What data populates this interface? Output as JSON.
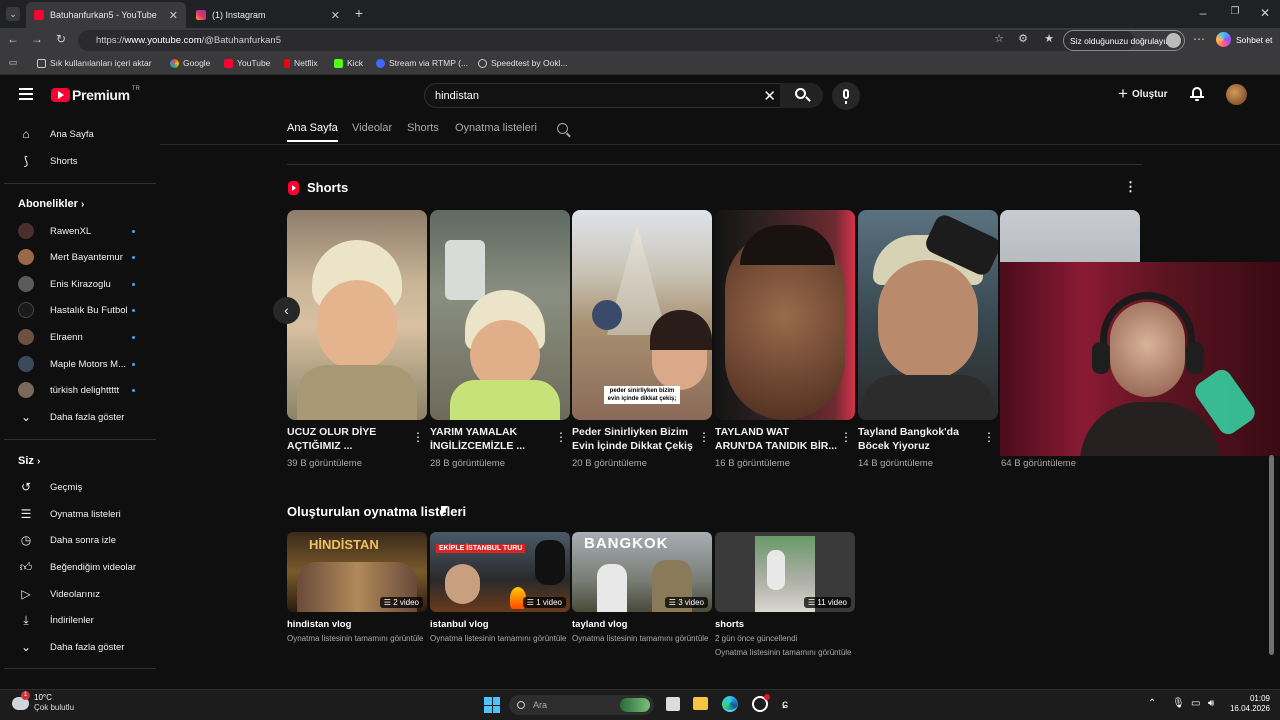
{
  "browser": {
    "tabs": [
      {
        "label": "Batuhanfurkan5 - YouTube",
        "active": true
      },
      {
        "label": "(1) Instagram",
        "active": false
      }
    ],
    "url_prefix": "https://",
    "url_host": "www.youtube.com",
    "url_path": "/@Batuhanfurkan5",
    "signin_text": "Siz olduğunuzu doğrulayın",
    "chat_label": "Sohbet et",
    "bookmarks": [
      "Sık kullanılanları içeri aktar",
      "Google",
      "YouTube",
      "Netflix",
      "Kick",
      "Stream via RTMP (...",
      "Speedtest by Ookl..."
    ]
  },
  "youtube": {
    "logo_text": "Premium",
    "logo_sup": "TR",
    "search_value": "hindistan",
    "create_label": "Oluştur",
    "channel_tabs": [
      "Ana Sayfa",
      "Videolar",
      "Shorts",
      "Oynatma listeleri"
    ]
  },
  "sidebar": {
    "top": [
      "Ana Sayfa",
      "Shorts"
    ],
    "subs_heading": "Abonelikler",
    "subscriptions": [
      "RawenXL",
      "Mert Bayantemur",
      "Enis Kirazoglu",
      "Hastalık Bu Futbol",
      "Elraenn",
      "Maple Motors M...",
      "türkish delighttttt"
    ],
    "subs_more": "Daha fazla göster",
    "you_heading": "Siz",
    "you_items": [
      "Geçmiş",
      "Oynatma listeleri",
      "Daha sonra izle",
      "Beğendiğim videolar",
      "Videolarınız",
      "İndirilenler"
    ],
    "you_more": "Daha fazla göster"
  },
  "shorts": {
    "heading": "Shorts",
    "items": [
      {
        "title1": "UCUZ OLUR DİYE",
        "title2": "AÇTIĞIMIZ ...",
        "views": "39 B görüntüleme"
      },
      {
        "title1": "YARIM YAMALAK",
        "title2": "İNGİLİZCEMİZLE ...",
        "views": "28 B görüntüleme"
      },
      {
        "title1": "Peder Sinirliyken Bizim",
        "title2": "Evin İçinde Dikkat Çekiş",
        "views": "20 B görüntüleme",
        "caption": "peder sinirliyken bizim evin içinde dikkat çekiş;"
      },
      {
        "title1": "TAYLAND WAT",
        "title2": "ARUN'DA TANIDIK BİR...",
        "views": "16 B görüntüleme"
      },
      {
        "title1": "Tayland Bangkok'da",
        "title2": "Böcek Yiyoruz",
        "views": "14 B görüntüleme"
      },
      {
        "title1": "",
        "title2": "",
        "views": "64 B görüntüleme"
      }
    ]
  },
  "playlists": {
    "heading": "Oluşturulan oynatma listeleri",
    "items": [
      {
        "title": "hindistan vlog",
        "count": "2 video",
        "sub1": "Oynatma listesinin tamamını görüntüle",
        "thumb_text": "HİNDİSTAN"
      },
      {
        "title": "istanbul vlog",
        "count": "1 video",
        "sub1": "Oynatma listesinin tamamını görüntüle",
        "thumb_text": "EKİPLE İSTANBUL TURU"
      },
      {
        "title": "tayland vlog",
        "count": "3 video",
        "sub1": "Oynatma listesinin tamamını görüntüle",
        "thumb_text": "BANGKOK"
      },
      {
        "title": "shorts",
        "count": "11 video",
        "sub1": "2 gün önce güncellendi",
        "sub2": "Oynatma listesinin tamamını görüntüle"
      }
    ]
  },
  "taskbar": {
    "temp": "10°C",
    "weather": "Çok bulutlu",
    "search_placeholder": "Ara",
    "time": "01:09",
    "date": "16.04.2026",
    "badge": "1"
  },
  "colors": {
    "yt_red": "#ff0033",
    "bg": "#0f0f0f",
    "link_blue": "#3ea6ff"
  }
}
